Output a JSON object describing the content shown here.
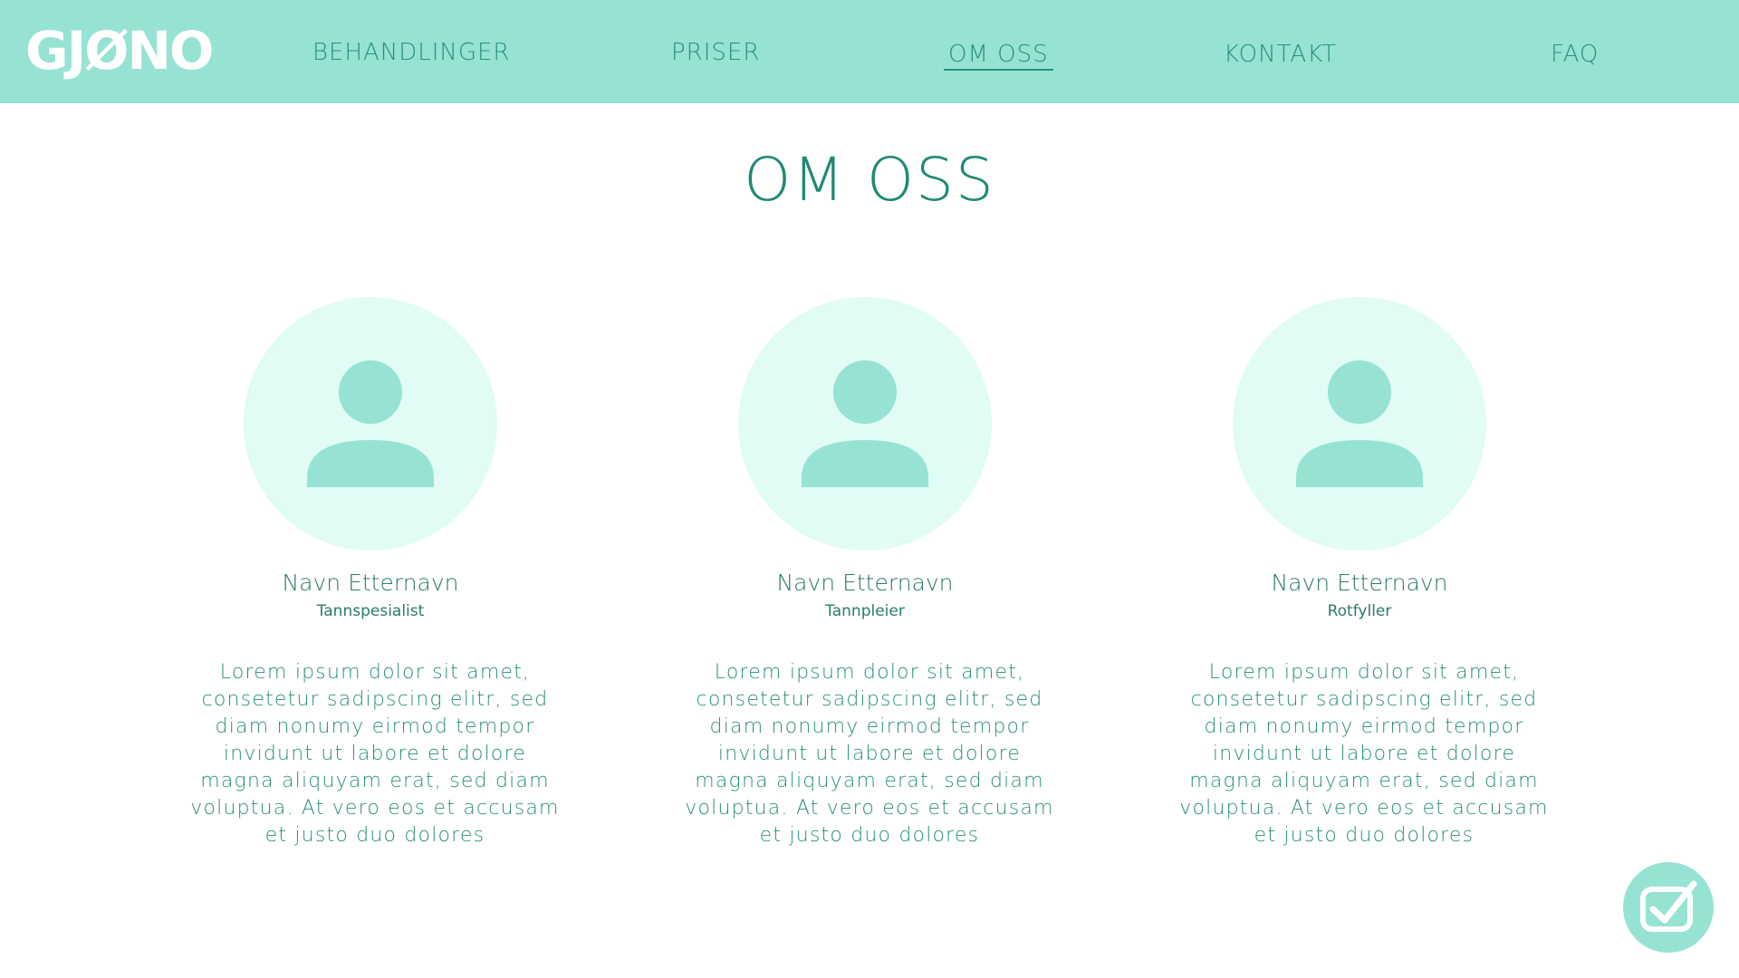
{
  "header": {
    "logo_text": "GJØNO",
    "nav": [
      {
        "label": "BEHANDLINGER"
      },
      {
        "label": "PRISER"
      },
      {
        "label": "OM OSS",
        "active": true
      },
      {
        "label": "KONTAKT"
      },
      {
        "label": "FAQ"
      }
    ]
  },
  "main": {
    "title": "OM OSS",
    "members": [
      {
        "name": "Navn Etternavn",
        "role": "Tannspesialist",
        "bio": "Lorem ipsum dolor sit amet, consetetur sadipscing elitr, sed diam nonumy eirmod tempor invidunt ut labore et dolore magna aliquyam erat, sed diam voluptua. At vero eos et accusam et justo duo dolores"
      },
      {
        "name": "Navn Etternavn",
        "role": "Tannpleier",
        "bio": "Lorem ipsum dolor sit amet, consetetur sadipscing elitr, sed diam nonumy eirmod tempor invidunt ut labore et dolore magna aliquyam erat, sed diam voluptua. At vero eos et accusam et justo duo dolores"
      },
      {
        "name": "Navn Etternavn",
        "role": "Rotfyller",
        "bio": "Lorem ipsum dolor sit amet, consetetur sadipscing elitr, sed diam nonumy eirmod tempor invidunt ut labore et dolore magna aliquyam erat, sed diam voluptua. At vero eos et accusam et justo duo dolores"
      }
    ]
  },
  "icons": {
    "avatar": "user-icon",
    "fab": "checkbox-checked-icon"
  },
  "colors": {
    "header_bg": "#96e3d3",
    "accent": "#1f8a73",
    "avatar_bg": "#e1fbf5",
    "avatar_fg": "#96e3d3"
  }
}
